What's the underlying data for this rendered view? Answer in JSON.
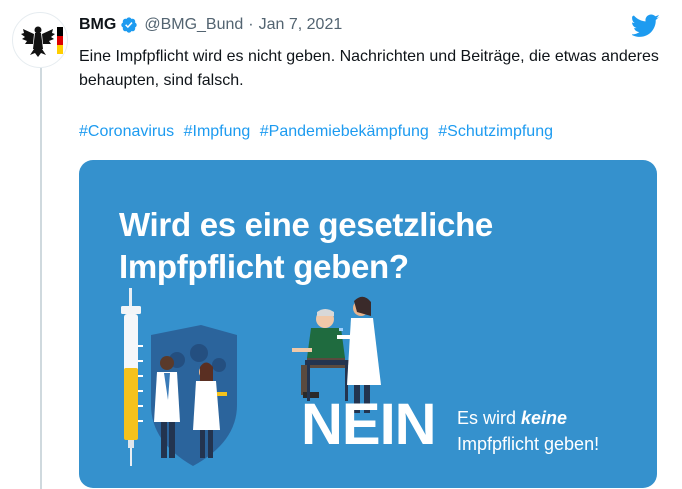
{
  "tweet": {
    "author_name": "BMG",
    "handle": "@BMG_Bund",
    "separator": "·",
    "date": "Jan 7, 2021",
    "text": "Eine Impfpflicht wird es nicht geben. Nachrichten und Beiträge, die etwas anderes behaupten, sind falsch.",
    "hashtags": [
      "#Coronavirus",
      "#Impfung",
      "#Pandemiebekämpfung",
      "#Schutzimpfung"
    ]
  },
  "media": {
    "headline_line1": "Wird es eine gesetzliche",
    "headline_line2": "Impfpflicht geben?",
    "answer_big": "NEIN",
    "answer_line1_prefix": "Es wird ",
    "answer_line1_emph": "keine",
    "answer_line2": "Impfpflicht geben!",
    "background_color": "#3591cd"
  },
  "icons": {
    "avatar": "federal-eagle-icon",
    "verified": "verified-badge-icon",
    "platform": "twitter-bird-icon"
  },
  "colors": {
    "link": "#1d9bf0",
    "muted": "#536471",
    "verified": "#1d9bf0"
  }
}
